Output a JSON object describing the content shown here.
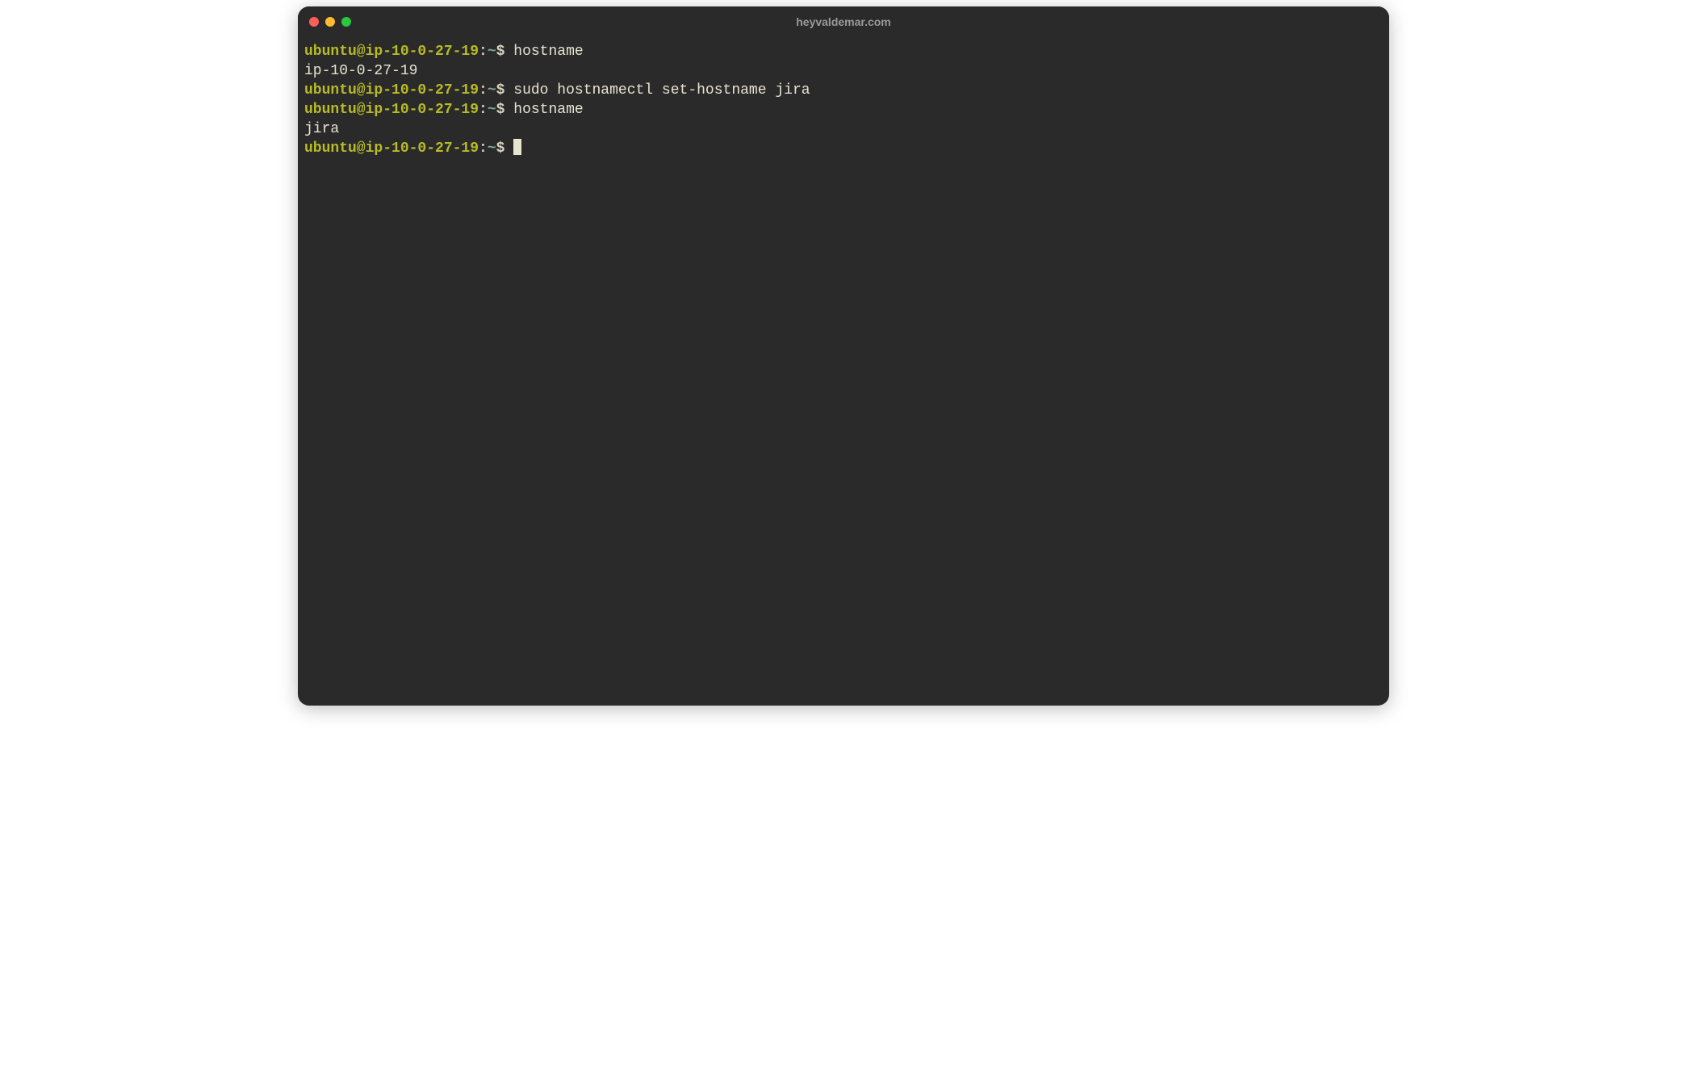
{
  "window": {
    "title": "heyvaldemar.com"
  },
  "prompt": {
    "user_host": "ubuntu@ip-10-0-27-19",
    "colon": ":",
    "path": "~",
    "dollar": "$"
  },
  "lines": [
    {
      "type": "prompt",
      "command": "hostname"
    },
    {
      "type": "output",
      "text": "ip-10-0-27-19"
    },
    {
      "type": "prompt",
      "command": "sudo hostnamectl set-hostname jira"
    },
    {
      "type": "prompt",
      "command": "hostname"
    },
    {
      "type": "output",
      "text": "jira"
    },
    {
      "type": "prompt",
      "command": "",
      "cursor": true
    }
  ]
}
